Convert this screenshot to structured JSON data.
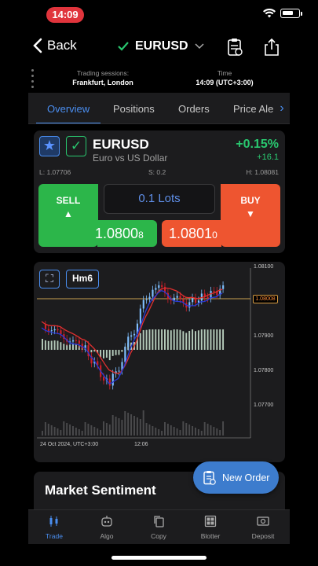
{
  "status_bar": {
    "time": "14:09"
  },
  "nav": {
    "back_label": "Back",
    "symbol": "EURUSD"
  },
  "sessions": {
    "left_label": "Trading sessions:",
    "left_value": "Frankfurt, London",
    "right_label": "Time",
    "right_value": "14:09 (UTC+3:00)"
  },
  "tabs": [
    "Overview",
    "Positions",
    "Orders",
    "Price Ale"
  ],
  "symbol_card": {
    "name": "EURUSD",
    "description": "Euro vs US Dollar",
    "change_pct": "+0.15%",
    "change_points": "+16.1",
    "low": "L: 1.07706",
    "spread": "S: 0.2",
    "high": "H: 1.08081",
    "sell_label": "SELL",
    "sell_price_main": "1.0800",
    "sell_price_small": "8",
    "buy_label": "BUY",
    "buy_price_main": "1.0801",
    "buy_price_small": "0",
    "lots": "0.1 Lots"
  },
  "chart": {
    "timeframe": "Hm6",
    "y_ticks": [
      "1.08100",
      "1.07900",
      "1.07800",
      "1.07700"
    ],
    "current_price_tag": "1.08008",
    "x_labels": [
      "24 Oct 2024, UTC+3:00",
      "12:06"
    ],
    "colors": {
      "up": "#7fbfff",
      "down": "#d0202a",
      "ma_red": "#e03030",
      "ma_blue": "#2a3ad8",
      "price_line": "#c8a050",
      "histogram": "#cfe9d6"
    }
  },
  "sentiment": {
    "title": "Market Sentiment"
  },
  "new_order": {
    "label": "New Order",
    "icon": "clipboard-icon"
  },
  "bottom_tabs": [
    {
      "label": "Trade",
      "icon": "candlestick-icon",
      "active": true
    },
    {
      "label": "Algo",
      "icon": "robot-icon",
      "active": false
    },
    {
      "label": "Copy",
      "icon": "copy-icon",
      "active": false
    },
    {
      "label": "Blotter",
      "icon": "grid-icon",
      "active": false
    },
    {
      "label": "Deposit",
      "icon": "money-icon",
      "active": false
    }
  ]
}
